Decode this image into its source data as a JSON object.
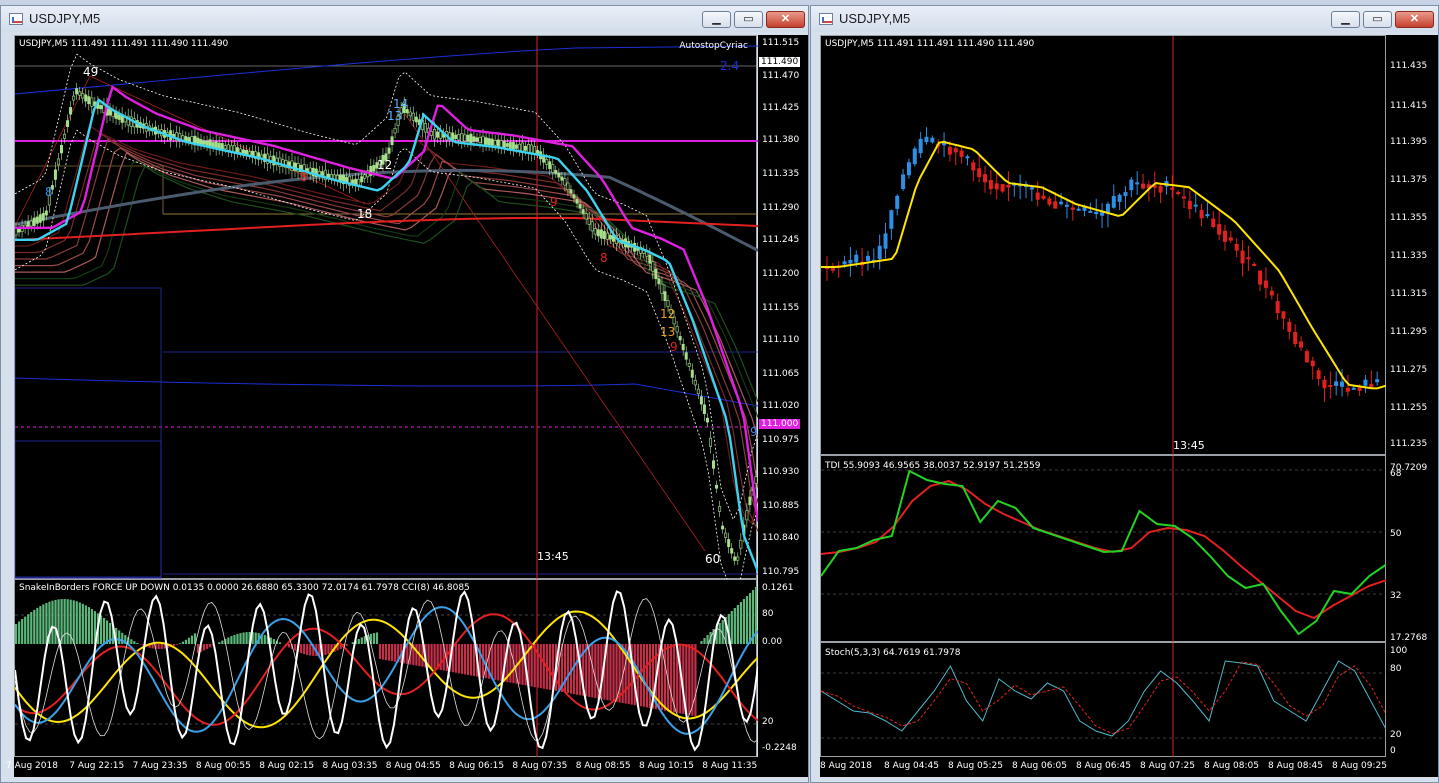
{
  "left_window": {
    "title": "USDJPY,M5",
    "controls": {
      "minimize": "▁",
      "maximize": "▭",
      "close": "✕"
    },
    "header": "USDJPY,M5  111.491 111.491 111.490 111.490",
    "expert_label": "AutostopCyriac",
    "price_ticks": [
      "111.515",
      "111.490",
      "111.470",
      "111.425",
      "111.380",
      "111.335",
      "111.290",
      "111.245",
      "111.200",
      "111.155",
      "111.110",
      "111.065",
      "111.020",
      "111.000",
      "110.975",
      "110.930",
      "110.885",
      "110.840",
      "110.795"
    ],
    "current_price": "111.490",
    "level_tag": "111.000",
    "annotations": [
      "49",
      "14",
      "13",
      "12",
      "8",
      "18",
      "9",
      "8",
      "8",
      "12",
      "13",
      "9",
      "60",
      "2.4",
      "9"
    ],
    "crosshair_time": "13:45",
    "sub_header": "SnakeInBorders FORCE UP DOWN  0.0135 0.0000  26.6880 65.3300 72.0174 61.7978  CCI(8) 46.8085",
    "sub_ticks": [
      "0.1261",
      "80",
      "0.00",
      "20",
      "-0.2248"
    ],
    "time_ticks": [
      "7 Aug 2018",
      "7 Aug 22:15",
      "7 Aug 23:35",
      "8 Aug 00:55",
      "8 Aug 02:15",
      "8 Aug 03:35",
      "8 Aug 04:55",
      "8 Aug 06:15",
      "8 Aug 07:35",
      "8 Aug 08:55",
      "8 Aug 10:15",
      "8 Aug 11:35"
    ]
  },
  "right_window": {
    "title": "USDJPY,M5",
    "controls": {
      "minimize": "▁",
      "maximize": "▭",
      "close": "✕"
    },
    "header": "USDJPY,M5  111.491 111.491 111.490 111.490",
    "price_ticks": [
      "111.435",
      "111.415",
      "111.395",
      "111.375",
      "111.355",
      "111.335",
      "111.315",
      "111.295",
      "111.275",
      "111.255",
      "111.235"
    ],
    "crosshair_time": "13:45",
    "tdi_header": "TDI 55.9093 46.9565 38.0037 52.9197 51.2559",
    "tdi_ticks": [
      "70.7209",
      "68",
      "50",
      "32",
      "17.2768"
    ],
    "stoch_header": "Stoch(5,3,3) 64.7619 61.7978",
    "stoch_ticks": [
      "100",
      "80",
      "20",
      "0"
    ],
    "time_ticks": [
      "8 Aug 2018",
      "8 Aug 04:45",
      "8 Aug 05:25",
      "8 Aug 06:05",
      "8 Aug 06:45",
      "8 Aug 07:25",
      "8 Aug 08:05",
      "8 Aug 08:45",
      "8 Aug 09:25"
    ]
  },
  "colors": {
    "bull": "#2e8fe6",
    "bear": "#e32020",
    "signal": "#ffe400",
    "tdi_green": "#22d322",
    "tdi_red": "#e32020",
    "magenta": "#e020e0",
    "cyan": "#3cd2f0"
  }
}
